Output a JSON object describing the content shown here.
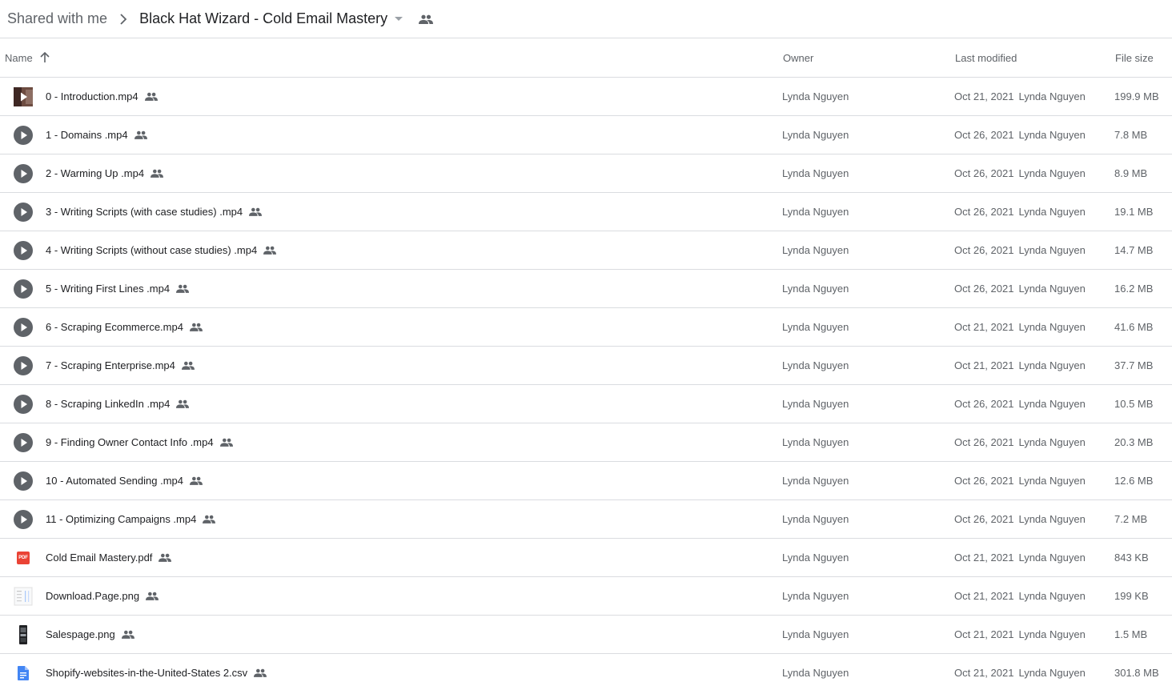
{
  "breadcrumb": {
    "root": "Shared with me",
    "current": "Black Hat Wizard - Cold Email Mastery"
  },
  "columns": {
    "name": "Name",
    "owner": "Owner",
    "last_modified": "Last modified",
    "file_size": "File size"
  },
  "colors": {
    "accent_grey": "#5f6368",
    "divider": "#dadce0",
    "pdf_red": "#ea4335",
    "doc_blue": "#4285f4"
  },
  "files": [
    {
      "name": "0 - Introduction.mp4",
      "icon": "video-thumbnail-icon",
      "owner": "Lynda Nguyen",
      "date": "Oct 21, 2021",
      "modified_by": "Lynda Nguyen",
      "size": "199.9 MB"
    },
    {
      "name": "1 - Domains .mp4",
      "icon": "play-video-icon",
      "owner": "Lynda Nguyen",
      "date": "Oct 26, 2021",
      "modified_by": "Lynda Nguyen",
      "size": "7.8 MB"
    },
    {
      "name": "2 - Warming Up .mp4",
      "icon": "play-video-icon",
      "owner": "Lynda Nguyen",
      "date": "Oct 26, 2021",
      "modified_by": "Lynda Nguyen",
      "size": "8.9 MB"
    },
    {
      "name": "3 - Writing Scripts (with case studies) .mp4",
      "icon": "play-video-icon",
      "owner": "Lynda Nguyen",
      "date": "Oct 26, 2021",
      "modified_by": "Lynda Nguyen",
      "size": "19.1 MB"
    },
    {
      "name": "4 - Writing Scripts (without case studies) .mp4",
      "icon": "play-video-icon",
      "owner": "Lynda Nguyen",
      "date": "Oct 26, 2021",
      "modified_by": "Lynda Nguyen",
      "size": "14.7 MB"
    },
    {
      "name": "5 - Writing First Lines .mp4",
      "icon": "play-video-icon",
      "owner": "Lynda Nguyen",
      "date": "Oct 26, 2021",
      "modified_by": "Lynda Nguyen",
      "size": "16.2 MB"
    },
    {
      "name": "6 - Scraping Ecommerce.mp4",
      "icon": "play-video-icon",
      "owner": "Lynda Nguyen",
      "date": "Oct 21, 2021",
      "modified_by": "Lynda Nguyen",
      "size": "41.6 MB"
    },
    {
      "name": "7 - Scraping Enterprise.mp4",
      "icon": "play-video-icon",
      "owner": "Lynda Nguyen",
      "date": "Oct 21, 2021",
      "modified_by": "Lynda Nguyen",
      "size": "37.7 MB"
    },
    {
      "name": "8 - Scraping LinkedIn .mp4",
      "icon": "play-video-icon",
      "owner": "Lynda Nguyen",
      "date": "Oct 26, 2021",
      "modified_by": "Lynda Nguyen",
      "size": "10.5 MB"
    },
    {
      "name": "9 - Finding Owner Contact Info .mp4",
      "icon": "play-video-icon",
      "owner": "Lynda Nguyen",
      "date": "Oct 26, 2021",
      "modified_by": "Lynda Nguyen",
      "size": "20.3 MB"
    },
    {
      "name": "10 - Automated Sending .mp4",
      "icon": "play-video-icon",
      "owner": "Lynda Nguyen",
      "date": "Oct 26, 2021",
      "modified_by": "Lynda Nguyen",
      "size": "12.6 MB"
    },
    {
      "name": "11 - Optimizing Campaigns .mp4",
      "icon": "play-video-icon",
      "owner": "Lynda Nguyen",
      "date": "Oct 26, 2021",
      "modified_by": "Lynda Nguyen",
      "size": "7.2 MB"
    },
    {
      "name": "Cold Email Mastery.pdf",
      "icon": "pdf-icon",
      "icon_text": "PDF",
      "owner": "Lynda Nguyen",
      "date": "Oct 21, 2021",
      "modified_by": "Lynda Nguyen",
      "size": "843 KB"
    },
    {
      "name": "Download.Page.png",
      "icon": "image-thumbnail-icon",
      "owner": "Lynda Nguyen",
      "date": "Oct 21, 2021",
      "modified_by": "Lynda Nguyen",
      "size": "199 KB"
    },
    {
      "name": "Salespage.png",
      "icon": "phone-image-thumbnail-icon",
      "owner": "Lynda Nguyen",
      "date": "Oct 21, 2021",
      "modified_by": "Lynda Nguyen",
      "size": "1.5 MB"
    },
    {
      "name": "Shopify-websites-in-the-United-States 2.csv",
      "icon": "document-icon",
      "owner": "Lynda Nguyen",
      "date": "Oct 21, 2021",
      "modified_by": "Lynda Nguyen",
      "size": "301.8 MB"
    }
  ]
}
